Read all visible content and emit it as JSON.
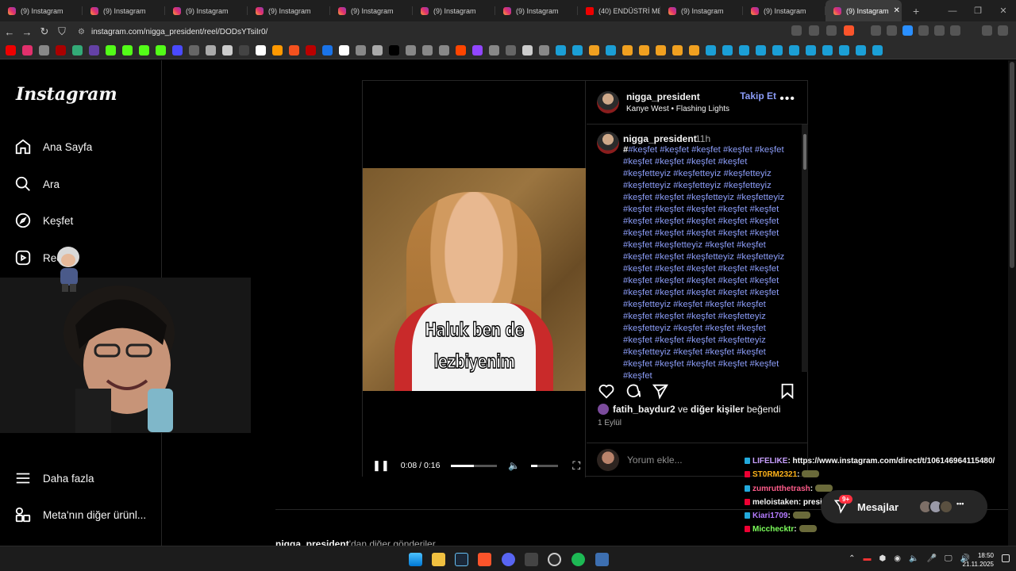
{
  "browser": {
    "tabs": [
      {
        "title": "(9) Instagram",
        "icon": "instagram-icon",
        "active": false
      },
      {
        "title": "(9) Instagram",
        "icon": "instagram-icon",
        "active": false
      },
      {
        "title": "(9) Instagram",
        "icon": "instagram-icon",
        "active": false
      },
      {
        "title": "(9) Instagram",
        "icon": "instagram-icon",
        "active": false
      },
      {
        "title": "(9) Instagram",
        "icon": "instagram-icon",
        "active": false
      },
      {
        "title": "(9) Instagram",
        "icon": "instagram-icon",
        "active": false
      },
      {
        "title": "(9) Instagram",
        "icon": "instagram-icon",
        "active": false
      },
      {
        "title": "(40) ENDÜSTRİ ME",
        "icon": "youtube-icon",
        "active": false
      },
      {
        "title": "(9) Instagram",
        "icon": "instagram-icon",
        "active": false
      },
      {
        "title": "(9) Instagram",
        "icon": "instagram-icon",
        "active": false
      },
      {
        "title": "(9) Instagram",
        "icon": "instagram-icon",
        "active": true
      }
    ],
    "url": "instagram.com/nigga_president/reel/DODsYTsiIr0/"
  },
  "sidebar": {
    "logo": "Instagram",
    "items": [
      "Ana Sayfa",
      "Ara",
      "Keşfet",
      "Reels",
      "Daha fazla",
      "Meta'nın diğer ürünl..."
    ]
  },
  "post": {
    "username": "nigga_president",
    "music": "Kanye West • Flashing Lights",
    "follow_label": "Takip Et",
    "time": "11h",
    "caption_prefix": "#",
    "caption": "#keşfet #keşfet #keşfet #keşfet #keşfet #keşfet #keşfet #keşfet #keşfet #keşfetteyiz #keşfetteyiz #keşfetteyiz #keşfetteyiz #keşfetteyiz #keşfetteyiz #keşfet #keşfet #keşfetteyiz #keşfetteyiz #keşfet #keşfet #keşfet #keşfet #keşfet #keşfet #keşfet #keşfet #keşfet #keşfet #keşfet #keşfet #keşfet #keşfet #keşfet #keşfet #keşfetteyiz #keşfet #keşfet #keşfet #keşfet #keşfetteyiz #keşfetteyiz #keşfet #keşfet #keşfet #keşfet #keşfet #keşfet #keşfet #keşfet #keşfet #keşfet #keşfet #keşfet #keşfet #keşfet #keşfet #keşfetteyiz #keşfet #keşfet #keşfet #keşfet #keşfet #keşfet #keşfetteyiz #keşfetteyiz #keşfet #keşfet #keşfet #keşfet #keşfet #keşfet #keşfetteyiz #keşfetteyiz #keşfet #keşfet #keşfet #keşfet #keşfet #keşfet #keşfet #keşfet #keşfet",
    "subtitle_line1": "Haluk ben de",
    "subtitle_line2": "lezbiyenim",
    "time_display": "0:08 / 0:16",
    "progress": 0.5,
    "likes_user": "fatih_baydur2",
    "likes_mid": " ve ",
    "likes_others": "diğer kişiler",
    "likes_suffix": " beğendi",
    "date": "1 Eylül",
    "comment_placeholder": "Yorum ekle...",
    "more_from_user": "nigga_president",
    "more_from_suffix": "'dan diğer gönderiler"
  },
  "chat": [
    {
      "user": "LIFELIKE",
      "msg": ": https://www.instagram.com/direct/t/106146964115480/",
      "color": "#c8a0ff"
    },
    {
      "user": "ST0RM2321",
      "msg": ":",
      "color": "#ffb31a"
    },
    {
      "user": "zumrutthetrash",
      "msg": ":",
      "color": "#ff5c8a"
    },
    {
      "user": "meloistaken",
      "msg": ": president",
      "color": "#f2f2f2"
    },
    {
      "user": "Kiari1709",
      "msg": ":",
      "color": "#b57bff"
    },
    {
      "user": "Micchecktr",
      "msg": ":",
      "color": "#7dff5c"
    }
  ],
  "messages": {
    "label": "Mesajlar",
    "badge": "9+"
  },
  "clock": {
    "time": "18:50",
    "date": "21.11.2025"
  }
}
